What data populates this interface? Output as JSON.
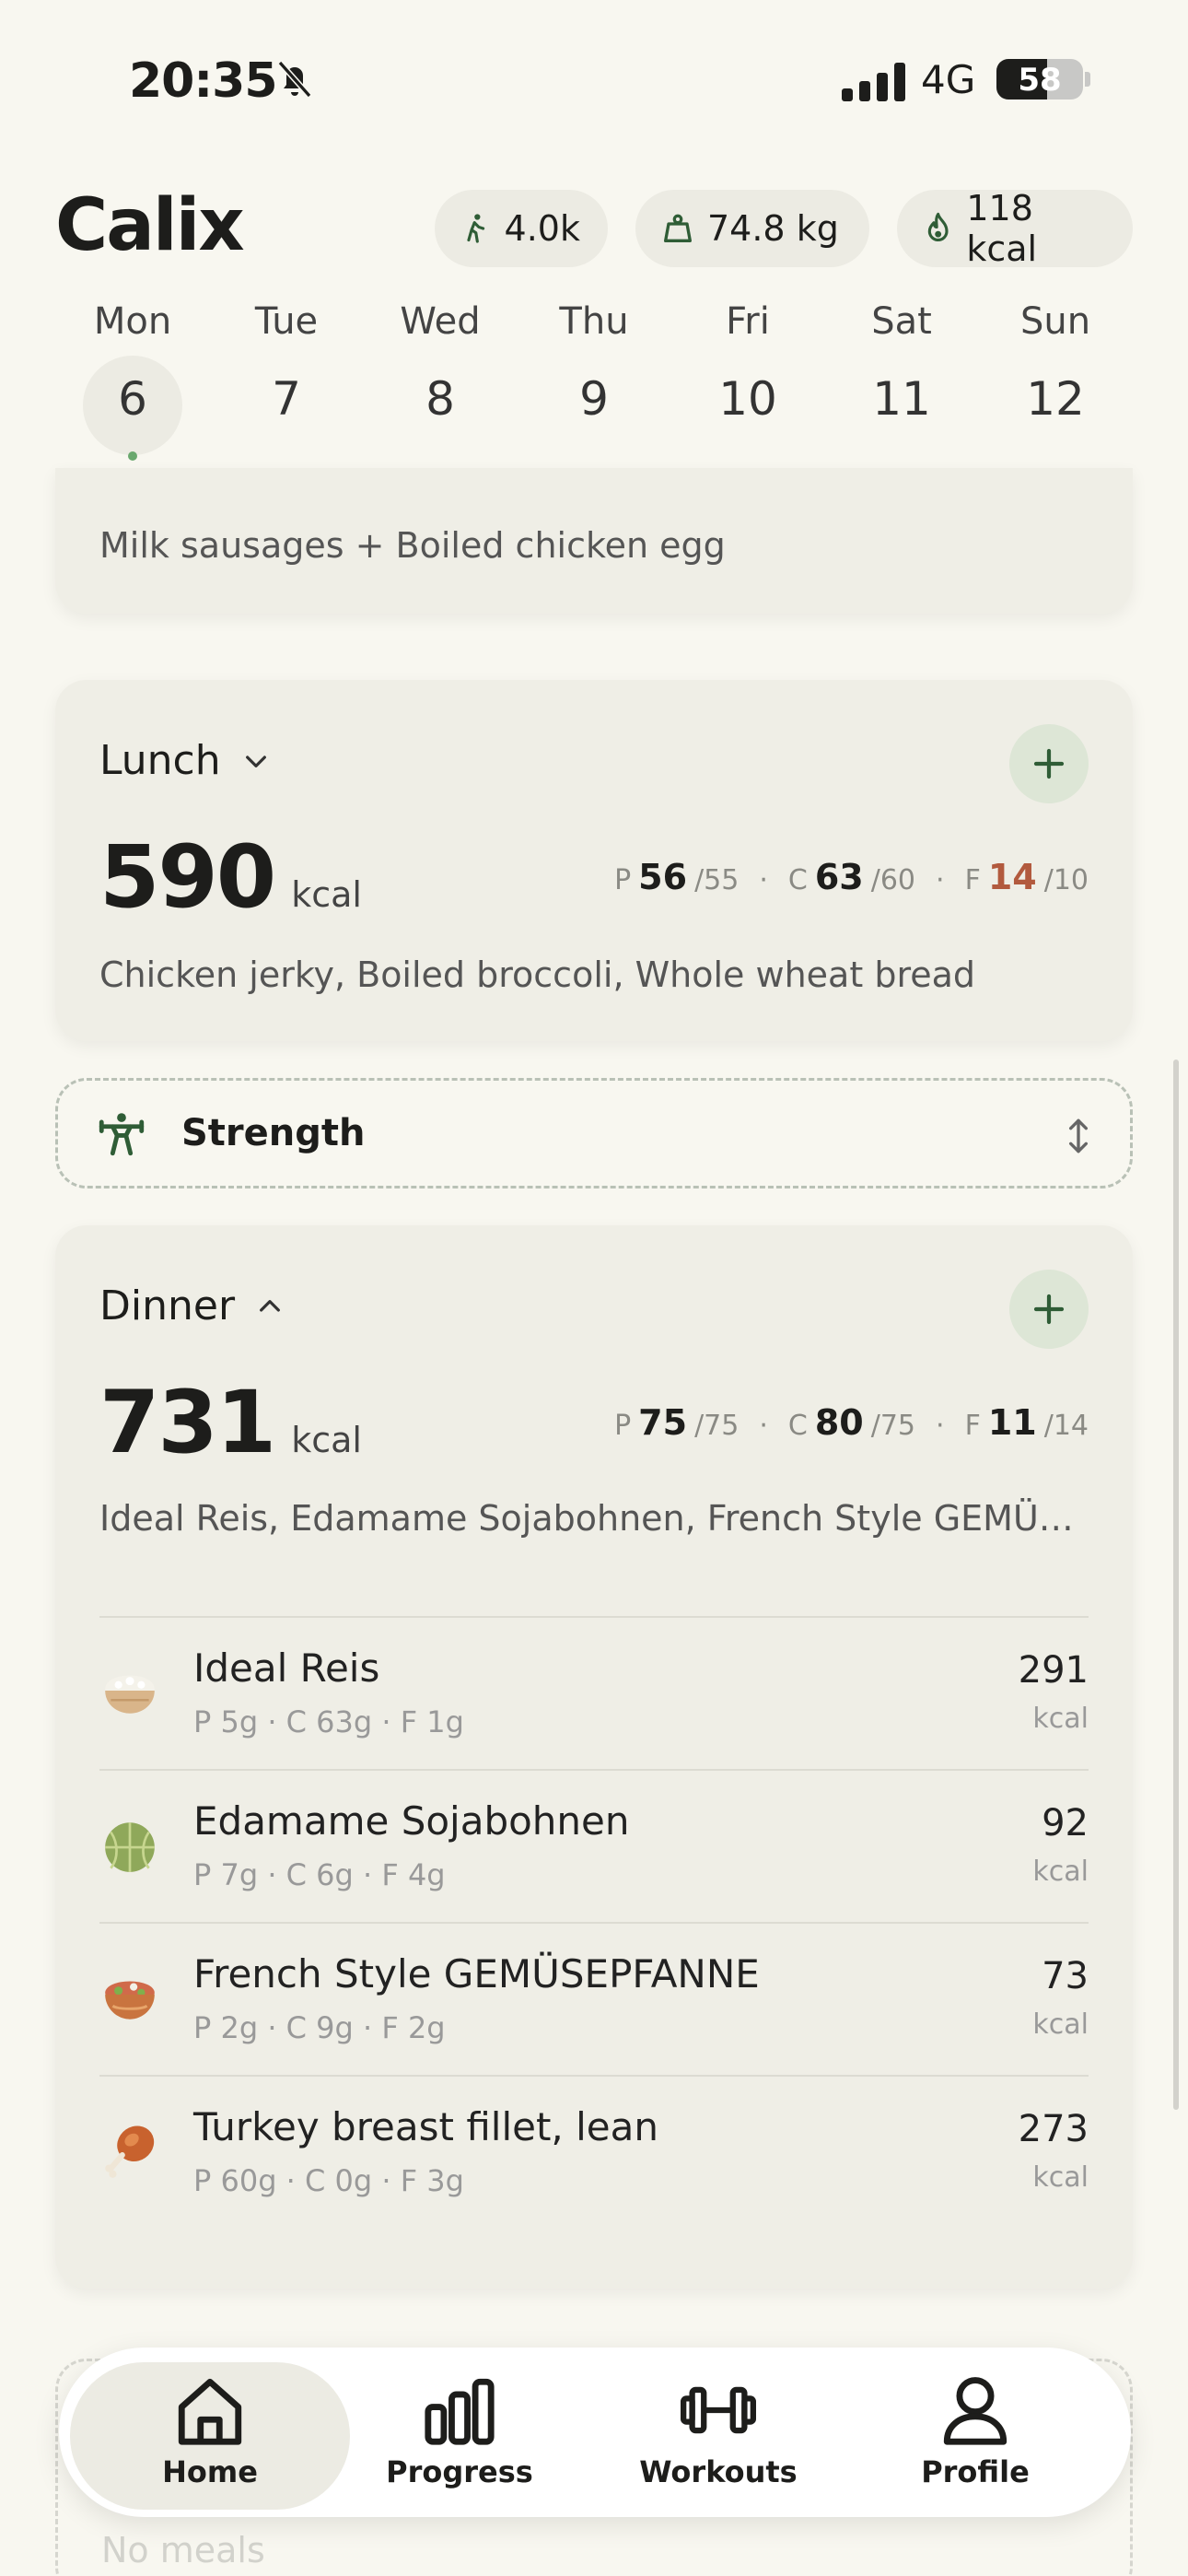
{
  "status_bar": {
    "time": "20:35",
    "network": "4G",
    "battery": "58"
  },
  "header": {
    "title": "Calix",
    "chips": {
      "steps": "4.0k",
      "weight": "74.8 kg",
      "burned": "118 kcal"
    }
  },
  "week": {
    "days": [
      {
        "name": "Mon",
        "num": "6"
      },
      {
        "name": "Tue",
        "num": "7"
      },
      {
        "name": "Wed",
        "num": "8"
      },
      {
        "name": "Thu",
        "num": "9"
      },
      {
        "name": "Fri",
        "num": "10"
      },
      {
        "name": "Sat",
        "num": "11"
      },
      {
        "name": "Sun",
        "num": "12"
      }
    ],
    "selected": "Mon"
  },
  "breakfast": {
    "desc": "Milk sausages + Boiled chicken egg"
  },
  "lunch": {
    "title": "Lunch",
    "kcal": "590",
    "kcal_unit": "kcal",
    "protein": {
      "label": "P",
      "value": "56",
      "target": "/55"
    },
    "carbs": {
      "label": "C",
      "value": "63",
      "target": "/60"
    },
    "fat": {
      "label": "F",
      "value": "14",
      "target": "/10"
    },
    "desc": "Chicken jerky, Boiled broccoli, Whole wheat bread"
  },
  "workout": {
    "label": "Strength"
  },
  "dinner": {
    "title": "Dinner",
    "kcal": "731",
    "kcal_unit": "kcal",
    "protein": {
      "label": "P",
      "value": "75",
      "target": "/75"
    },
    "carbs": {
      "label": "C",
      "value": "80",
      "target": "/75"
    },
    "fat": {
      "label": "F",
      "value": "11",
      "target": "/14"
    },
    "desc": "Ideal Reis, Edamame Sojabohnen, French Style GEMÜSE...",
    "items": [
      {
        "name": "Ideal Reis",
        "macros": "P 5g · C 63g · F 1g",
        "kcal": "291",
        "unit": "kcal",
        "icon": "rice-bowl-icon"
      },
      {
        "name": "Edamame Sojabohnen",
        "macros": "P 7g · C 6g · F 4g",
        "kcal": "92",
        "unit": "kcal",
        "icon": "melon-icon"
      },
      {
        "name": "French Style GEMÜSEPFANNE",
        "macros": "P 2g · C 9g · F 2g",
        "kcal": "73",
        "unit": "kcal",
        "icon": "salad-bowl-icon"
      },
      {
        "name": "Turkey breast fillet, lean",
        "macros": "P 60g · C 0g · F 3g",
        "kcal": "273",
        "unit": "kcal",
        "icon": "poultry-leg-icon"
      }
    ]
  },
  "ghost": {
    "text": "No meals"
  },
  "tabbar": {
    "home": "Home",
    "progress": "Progress",
    "workouts": "Workouts",
    "profile": "Profile"
  },
  "colors": {
    "accent_green": "#2f5d36",
    "over_target": "#b25a3e",
    "background": "#f8f7f0",
    "card": "#efeee6"
  }
}
